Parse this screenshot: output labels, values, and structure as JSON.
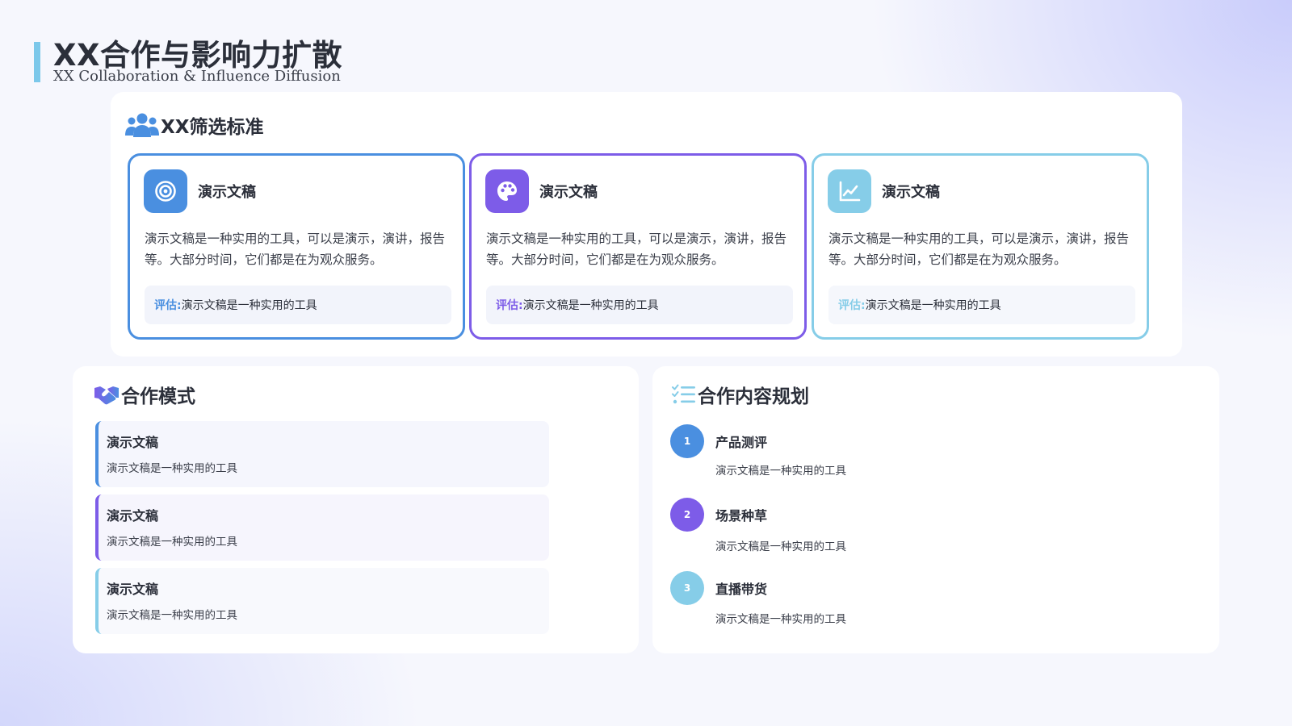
{
  "header": {
    "title": "XX合作与影响力扩散",
    "subtitle": "XX Collaboration & Influence Diffusion"
  },
  "colors": {
    "blue": "#4a8fe0",
    "purple": "#7d5ce8",
    "cyan": "#86cde8"
  },
  "criteria": {
    "heading": "XX筛选标准",
    "icon": "users-icon",
    "cards": [
      {
        "icon": "target-icon",
        "title": "演示文稿",
        "desc": "演示文稿是一种实用的工具，可以是演示，演讲，报告等。大部分时间，它们都是在为观众服务。",
        "eval_label": "评估:",
        "eval_text": "演示文稿是一种实用的工具"
      },
      {
        "icon": "palette-icon",
        "title": "演示文稿",
        "desc": "演示文稿是一种实用的工具，可以是演示，演讲，报告等。大部分时间，它们都是在为观众服务。",
        "eval_label": "评估:",
        "eval_text": "演示文稿是一种实用的工具"
      },
      {
        "icon": "line-chart-icon",
        "title": "演示文稿",
        "desc": "演示文稿是一种实用的工具，可以是演示，演讲，报告等。大部分时间，它们都是在为观众服务。",
        "eval_label": "评估:",
        "eval_text": "演示文稿是一种实用的工具"
      }
    ]
  },
  "modes": {
    "heading": "合作模式",
    "icon": "handshake-icon",
    "items": [
      {
        "title": "演示文稿",
        "desc": "演示文稿是一种实用的工具"
      },
      {
        "title": "演示文稿",
        "desc": "演示文稿是一种实用的工具"
      },
      {
        "title": "演示文稿",
        "desc": "演示文稿是一种实用的工具"
      }
    ]
  },
  "planning": {
    "heading": "合作内容规划",
    "icon": "list-check-icon",
    "items": [
      {
        "num": "1",
        "title": "产品测评",
        "desc": "演示文稿是一种实用的工具"
      },
      {
        "num": "2",
        "title": "场景种草",
        "desc": "演示文稿是一种实用的工具"
      },
      {
        "num": "3",
        "title": "直播带货",
        "desc": "演示文稿是一种实用的工具"
      }
    ]
  }
}
